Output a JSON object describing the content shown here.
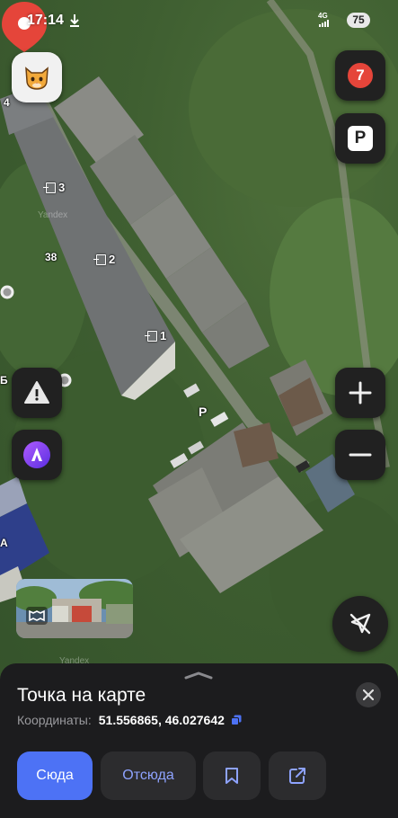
{
  "status_bar": {
    "time": "17:14",
    "network": "4G",
    "battery": "75"
  },
  "map": {
    "watermark": "Yandex",
    "house_number": "38",
    "edge_labels": [
      "4",
      "Б",
      "А"
    ],
    "entrances": [
      {
        "label": "3"
      },
      {
        "label": "2"
      },
      {
        "label": "1"
      }
    ],
    "parking_label": "P"
  },
  "controls": {
    "avatar_icon": "cat-avatar-icon",
    "traffic_score": "7",
    "parking_button": "P",
    "zoom_in": "+",
    "zoom_out": "−"
  },
  "sheet": {
    "title": "Точка на карте",
    "coords_label": "Координаты:",
    "coords_value": "51.556865, 46.027642",
    "buttons": {
      "route_to": "Сюда",
      "route_from": "Отсюда"
    }
  },
  "colors": {
    "accent": "#4d72f5",
    "pin": "#e5453a",
    "sheet_bg": "#1c1c1e"
  }
}
